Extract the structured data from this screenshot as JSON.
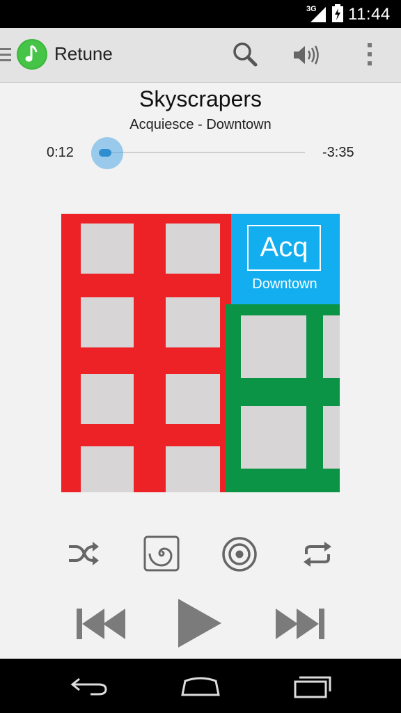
{
  "status_bar": {
    "network": "3G",
    "time": "11:44"
  },
  "app_bar": {
    "title": "Retune",
    "logo_icon": "music-note-icon"
  },
  "track": {
    "title": "Skyscrapers",
    "subtitle": "Acquiesce - Downtown",
    "elapsed": "0:12",
    "remaining": "-3:35",
    "progress_fraction": 0.05
  },
  "album_art": {
    "logo_text": "Acq",
    "caption": "Downtown"
  },
  "controls": {
    "icons": [
      "shuffle-icon",
      "spiral-effect-icon",
      "target-icon",
      "repeat-icon",
      "previous-icon",
      "play-icon",
      "next-icon"
    ]
  },
  "nav_bar": {
    "icons": [
      "back-icon",
      "home-icon",
      "recents-icon"
    ]
  },
  "colors": {
    "accent_blue": "#2f8ecf",
    "art_red": "#ec2227",
    "art_blue": "#12aeef",
    "art_green": "#0c9446",
    "logo_green": "#3bb63a"
  }
}
